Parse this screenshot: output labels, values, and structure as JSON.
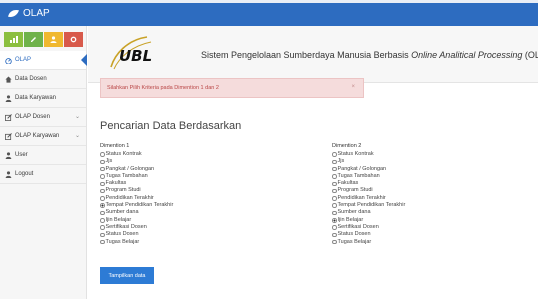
{
  "app": {
    "brand": "OLAP"
  },
  "sidebar": {
    "items": [
      {
        "label": "OLAP",
        "icon": "dashboard-icon",
        "active": true
      },
      {
        "label": "Data Dosen",
        "icon": "home-icon"
      },
      {
        "label": "Data Karyawan",
        "icon": "user-icon"
      },
      {
        "label": "OLAP Dosen",
        "icon": "edit-icon",
        "chevron": true
      },
      {
        "label": "OLAP Karyawan",
        "icon": "edit-icon",
        "chevron": true
      },
      {
        "label": "User",
        "icon": "user-icon"
      },
      {
        "label": "Logout",
        "icon": "user-icon"
      }
    ]
  },
  "header": {
    "logo_text": "UBL",
    "title_prefix": "Sistem Pengelolaan Sumberdaya Manusia Berbasis ",
    "title_italic": "Online Analitical Processing",
    "title_suffix": " (OLAP)"
  },
  "alert": {
    "message": "Silahkan Pilih Kriteria pada Dimention 1 dan 2",
    "close": "×"
  },
  "section_title": "Pencarian Data Berdasarkan",
  "dim1": {
    "heading": "Dimention 1",
    "options": [
      "Status Kontrak",
      "Jjs",
      "Pangkat / Golongan",
      "Tugas Tambahan",
      "Fakultas",
      "Program Studi",
      "Pendidikan Terakhir",
      "Tempat Pendidikan Terakhir",
      "Sumber dana",
      "Ijin Belajar",
      "Sertifikasi Dosen",
      "Status Dosen",
      "Tugas Belajar"
    ],
    "selected_index": 7
  },
  "dim2": {
    "heading": "Dimention 2",
    "options": [
      "Status Kontrak",
      "Jjs",
      "Pangkat / Golongan",
      "Tugas Tambahan",
      "Fakultas",
      "Program Studi",
      "Pendidikan Terakhir",
      "Tempat Pendidikan Terakhir",
      "Sumber dana",
      "Ijin Belajar",
      "Sertifikasi Dosen",
      "Status Dosen",
      "Tugas Belajar"
    ],
    "selected_index": 9
  },
  "submit_label": "Tampilkan data",
  "colors": {
    "primary": "#2d6cc0",
    "button": "#2d7bd5",
    "alert_bg": "#f5dcdc",
    "alert_text": "#b94646"
  }
}
